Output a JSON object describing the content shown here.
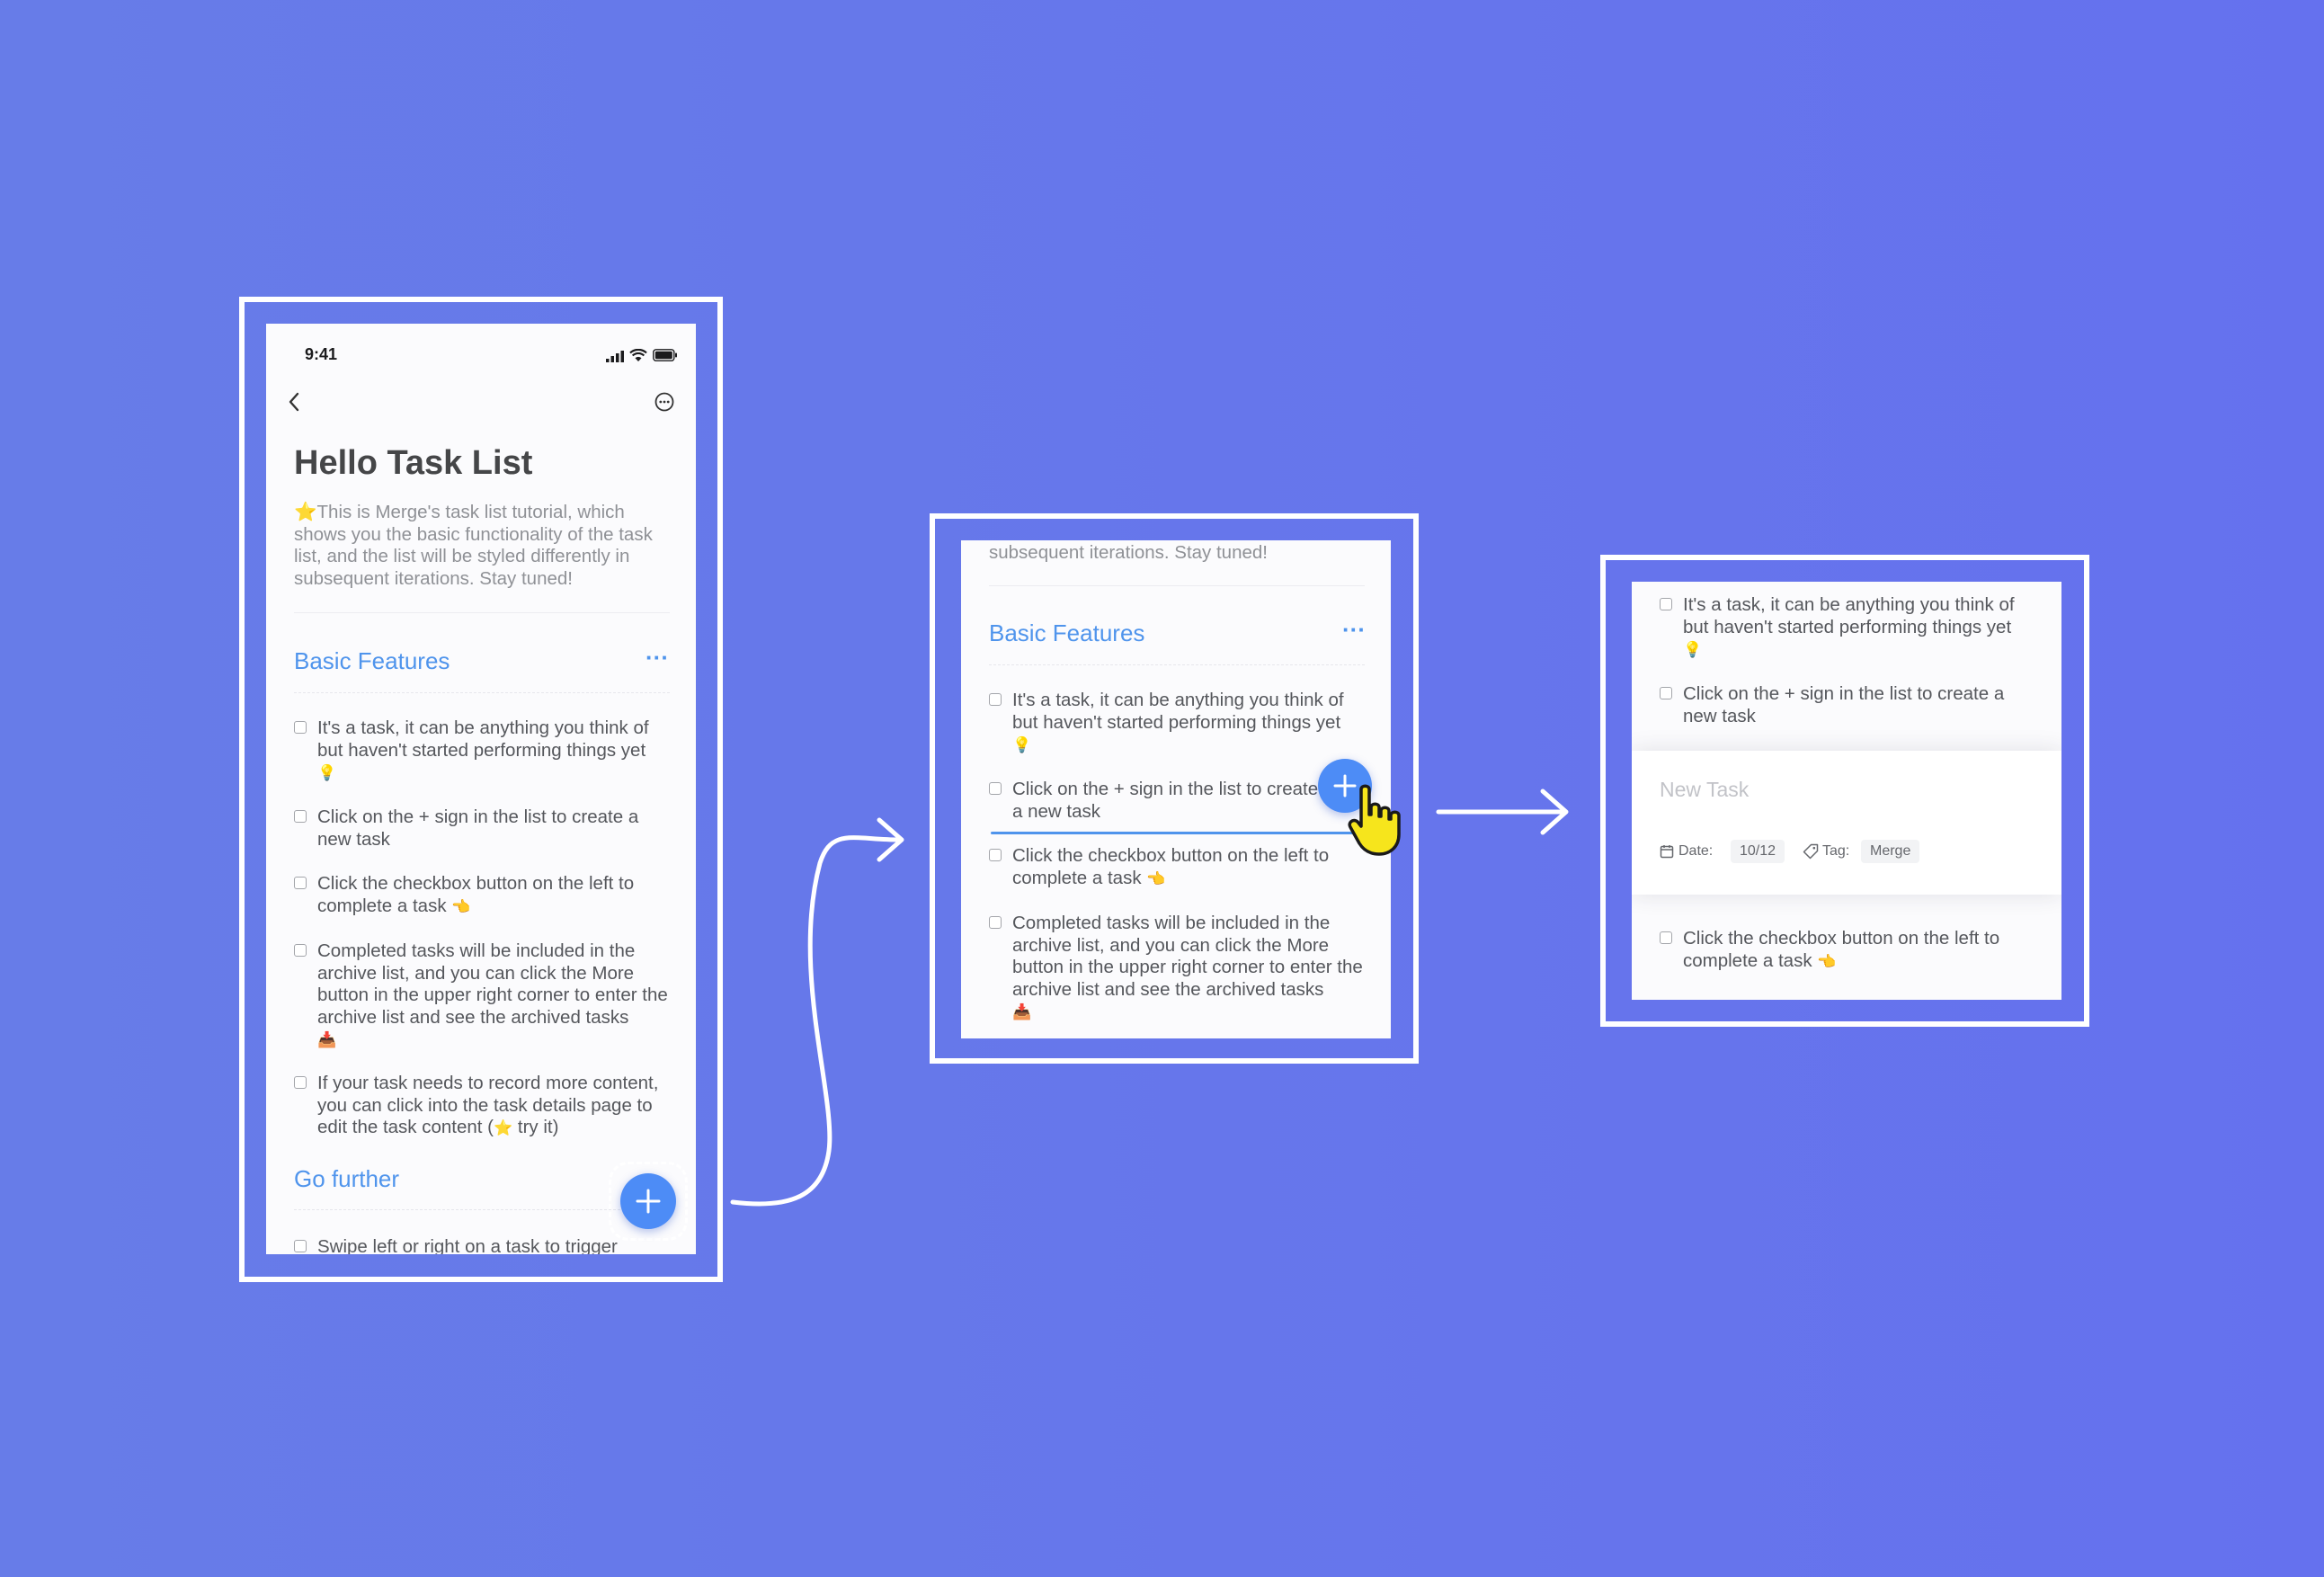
{
  "colors": {
    "background": "#6675ec",
    "accent_blue": "#4f94ec",
    "fab_blue": "#4d8cf6",
    "hand_yellow": "#f6e51c"
  },
  "screen1": {
    "status_time": "9:41",
    "title": "Hello Task List",
    "description_emoji": "⭐",
    "description": "This is Merge's task list tutorial, which shows you the basic functionality of the task list, and the list will be styled differently in subsequent iterations. Stay tuned!",
    "section_basic": "Basic Features",
    "section_more": "···",
    "tasks": [
      {
        "text": "It's a task, it can be anything you think of but haven't started performing things yet",
        "emoji": "💡"
      },
      {
        "text": "Click on the + sign in the list to create a new task",
        "emoji": ""
      },
      {
        "text": "Click the checkbox button on the left to complete a task",
        "emoji": "👈"
      },
      {
        "text": "Completed tasks will be included in the archive list, and you can click the More button in the upper right corner to enter the archive list and see the archived tasks",
        "emoji": "📥"
      },
      {
        "text_before": "If your task needs to record more content, you can click into the task details page to edit the task content (",
        "emoji": "⭐",
        "text_after": " try it)"
      }
    ],
    "section_further": "Go further",
    "further_task": "Swipe left or right on a task to trigger",
    "fab_label": "+"
  },
  "screen2": {
    "top_text": "subsequent iterations. Stay tuned!",
    "section_basic": "Basic Features",
    "section_more": "···",
    "tasks": [
      {
        "text": "It's a task, it can be anything you think of but haven't started performing things yet",
        "emoji": "💡"
      },
      {
        "text": "Click on the + sign in the list to create a new task",
        "emoji": ""
      },
      {
        "text": "Click the checkbox button on the left to complete a task",
        "emoji": "👈"
      },
      {
        "text": "Completed tasks will be included in the archive list, and you can click the More button in the upper right corner to enter the archive list and see the archived tasks",
        "emoji": "📥"
      }
    ],
    "fab_label": "+"
  },
  "screen3": {
    "tasks_top": [
      {
        "text": "It's a task, it can be anything you think of but haven't started performing things yet",
        "emoji": "💡"
      },
      {
        "text": "Click on the + sign in the list to create a new task",
        "emoji": ""
      }
    ],
    "new_task_placeholder": "New Task",
    "date_label": "Date:",
    "date_value": "10/12",
    "tag_label": "Tag:",
    "tag_value": "Merge",
    "tasks_bottom": [
      {
        "text": "Click the checkbox button on the left to complete a task",
        "emoji": "👈"
      }
    ]
  }
}
